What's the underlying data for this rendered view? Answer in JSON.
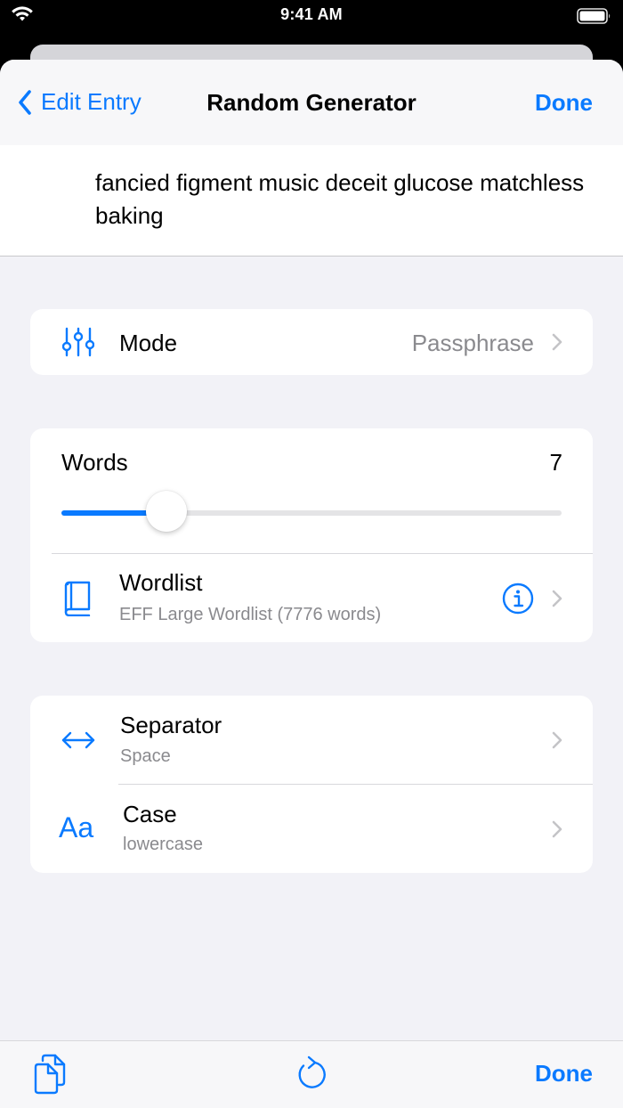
{
  "status_bar": {
    "time": "9:41 AM",
    "icons": [
      "wifi-icon",
      "battery-icon"
    ]
  },
  "nav": {
    "back_label": "Edit Entry",
    "title": "Random Generator",
    "done_label": "Done"
  },
  "passphrase": {
    "text": "fancied figment music deceit glucose matchless baking"
  },
  "mode": {
    "icon": "sliders-icon",
    "label": "Mode",
    "value": "Passphrase"
  },
  "words": {
    "label": "Words",
    "count": "7",
    "slider_fraction": 0.21
  },
  "wordlist": {
    "icon": "book-icon",
    "label": "Wordlist",
    "subtitle": "EFF Large Wordlist (7776 words)",
    "info_icon": "info-icon"
  },
  "separator": {
    "icon": "left-right-arrow-icon",
    "label": "Separator",
    "value": "Space"
  },
  "case": {
    "icon_text": "Aa",
    "label": "Case",
    "value": "lowercase"
  },
  "toolbar": {
    "copy_icon": "copy-icon",
    "refresh_icon": "refresh-icon",
    "done_label": "Done"
  },
  "colors": {
    "accent": "#0a7aff",
    "background": "#f2f2f7",
    "secondary_text": "#8a8a8e"
  }
}
